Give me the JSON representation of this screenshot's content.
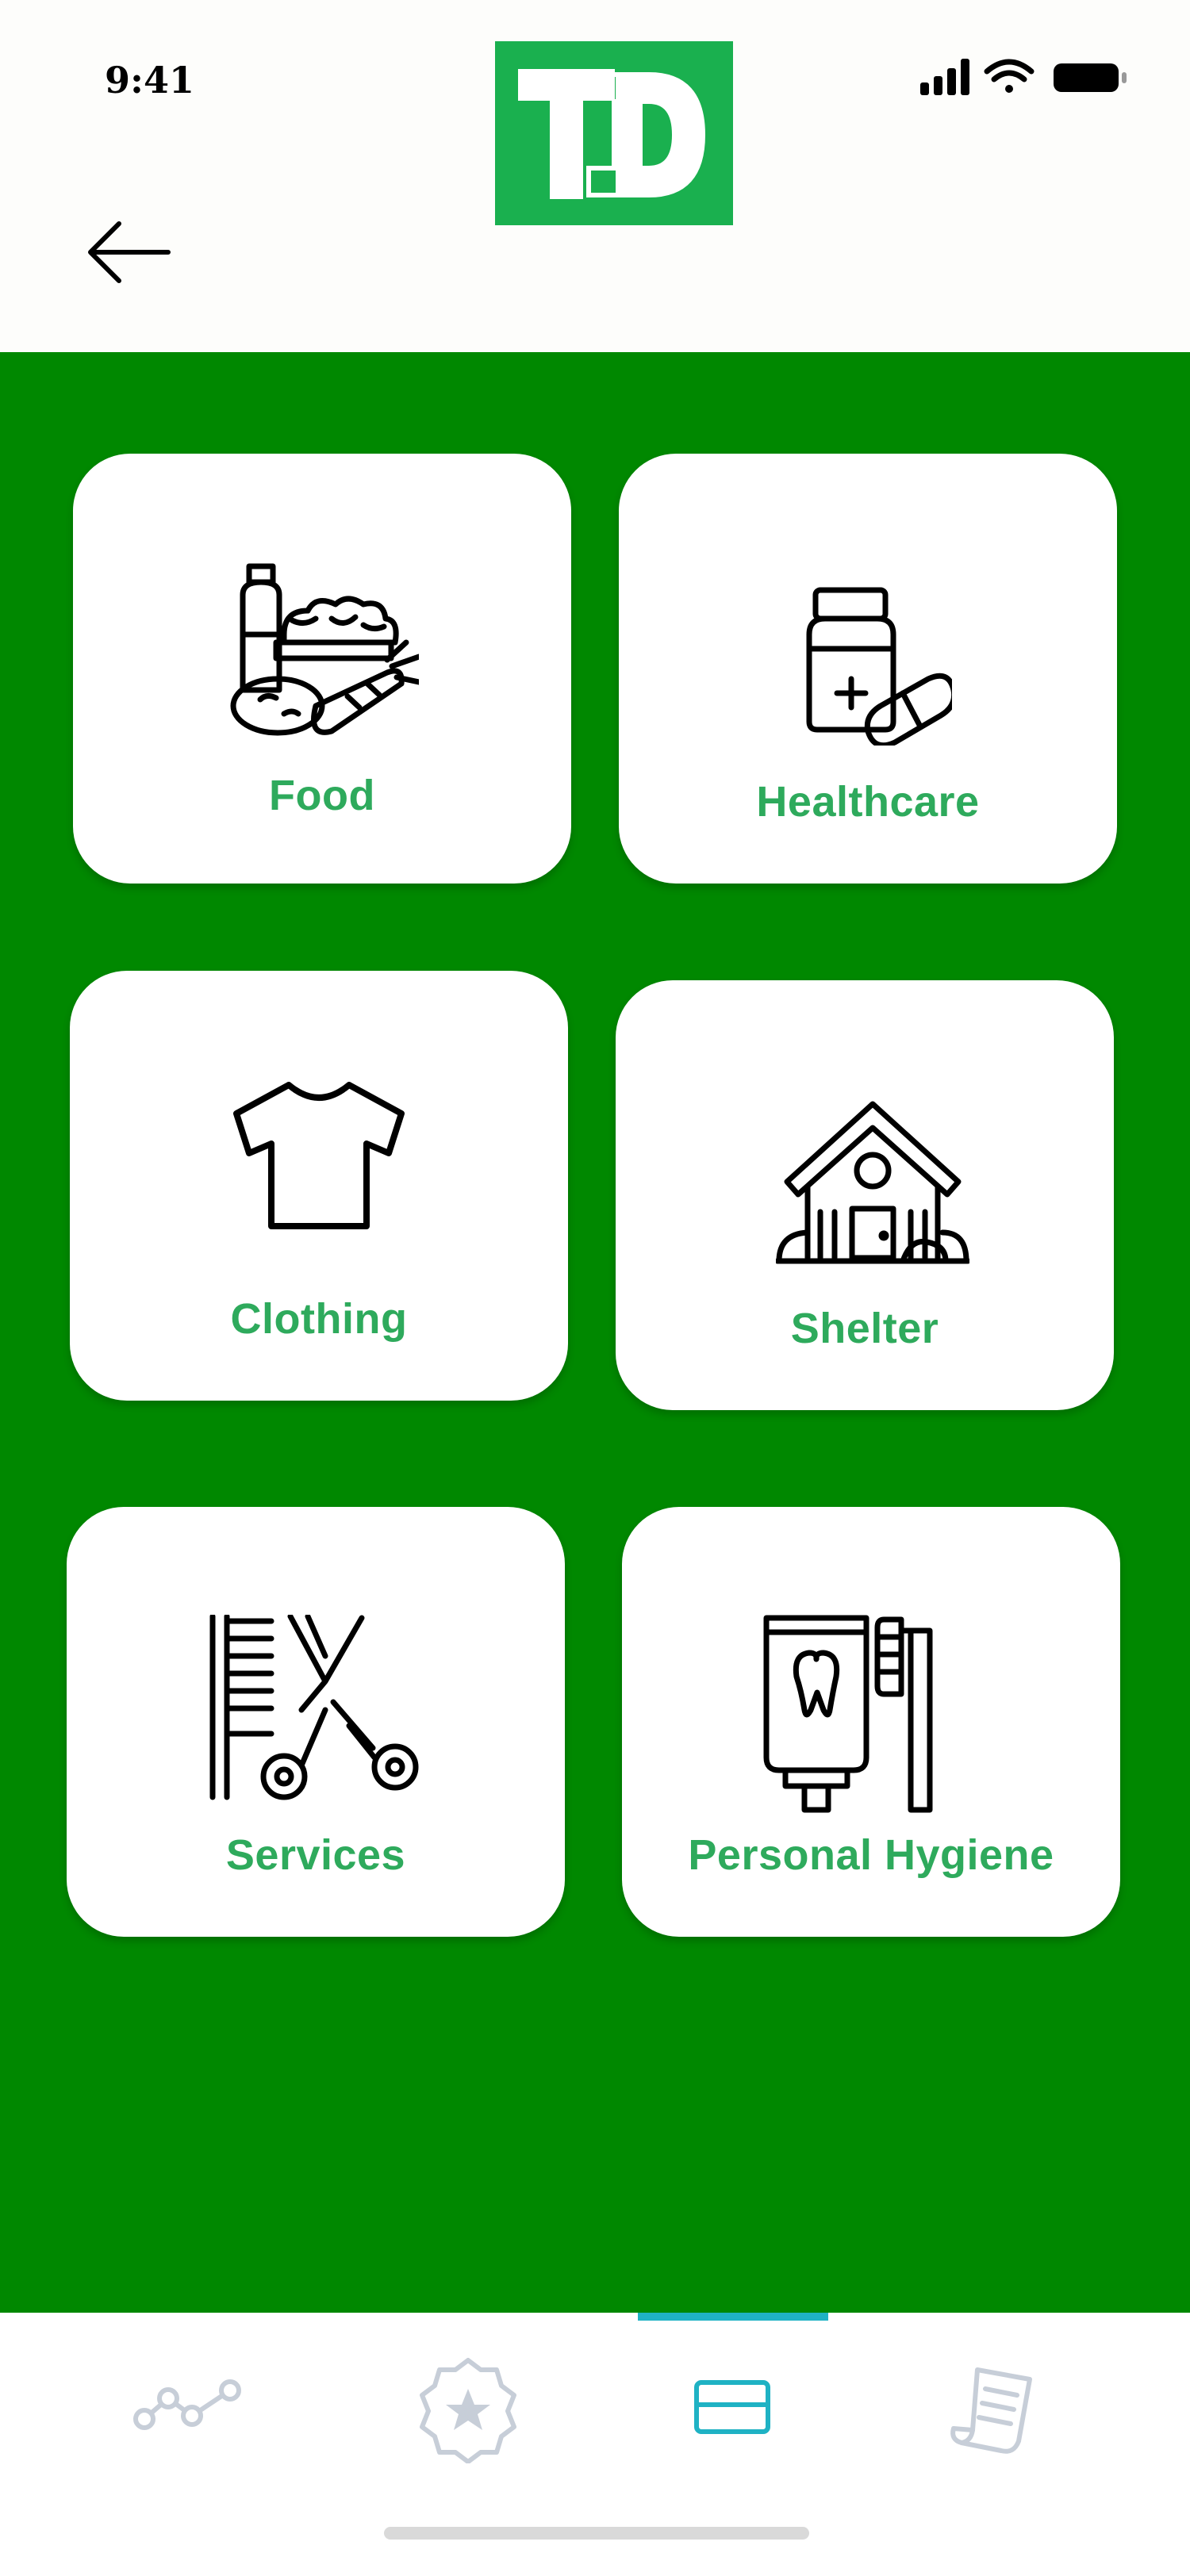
{
  "status_bar": {
    "time": "9:41"
  },
  "header": {
    "logo_text": "TD",
    "back_icon": "arrow-left-icon"
  },
  "categories": [
    {
      "label": "Food",
      "icon": "groceries-icon"
    },
    {
      "label": "Healthcare",
      "icon": "medicine-bottle-icon"
    },
    {
      "label": "Clothing",
      "icon": "tshirt-icon"
    },
    {
      "label": "Shelter",
      "icon": "house-icon"
    },
    {
      "label": "Services",
      "icon": "comb-scissors-icon"
    },
    {
      "label": "Personal Hygiene",
      "icon": "toothpaste-toothbrush-icon"
    }
  ],
  "tab_bar": {
    "tabs": [
      {
        "icon": "graph-icon",
        "active": false
      },
      {
        "icon": "star-badge-icon",
        "active": false
      },
      {
        "icon": "card-icon",
        "active": true
      },
      {
        "icon": "receipt-icon",
        "active": false
      }
    ]
  },
  "colors": {
    "main_background": "#008800",
    "logo_green": "#1ab04f",
    "label_green": "#2eaa5c",
    "active_tab": "#1fb2c4",
    "inactive_tab": "#c7ced8"
  }
}
